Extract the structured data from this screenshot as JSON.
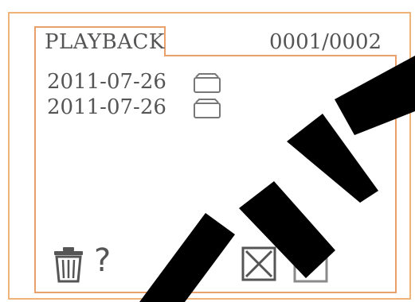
{
  "header": {
    "title": "PLAYBACK",
    "page_counter": "0001/0002"
  },
  "files": [
    {
      "date": "2011-07-26",
      "icon": "folder-icon"
    },
    {
      "date": "2011-07-26",
      "icon": "folder-icon"
    }
  ],
  "toolbar": {
    "delete_icon": "trash-icon",
    "help_label": "?",
    "cancel_icon": "cancel-x-icon",
    "confirm_icon": "confirm-check-icon"
  },
  "colors": {
    "border_accent": "#e9a06a",
    "text": "#555555",
    "watermark": "#000000"
  }
}
